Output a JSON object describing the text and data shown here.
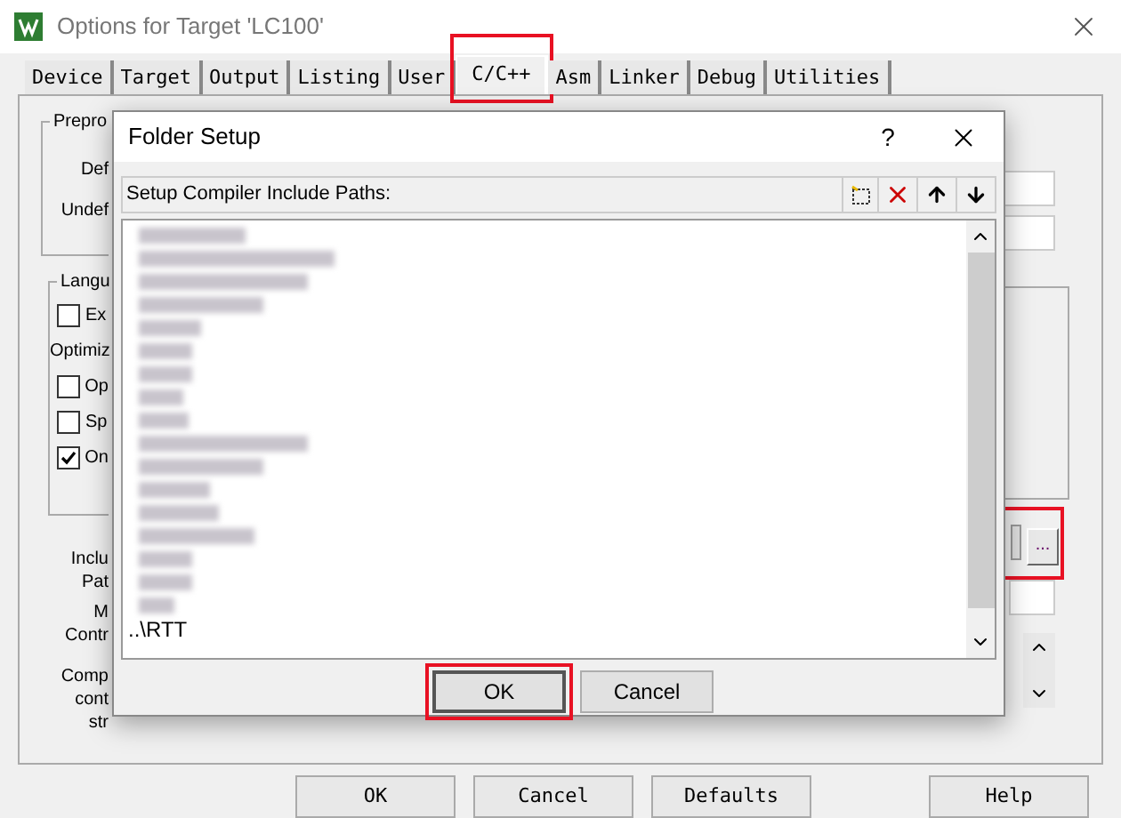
{
  "window": {
    "title": "Options for Target 'LC100'"
  },
  "tabs": [
    {
      "label": "Device",
      "selected": false,
      "highlighted": false
    },
    {
      "label": "Target",
      "selected": false,
      "highlighted": false
    },
    {
      "label": "Output",
      "selected": false,
      "highlighted": false
    },
    {
      "label": "Listing",
      "selected": false,
      "highlighted": false
    },
    {
      "label": "User",
      "selected": false,
      "highlighted": false
    },
    {
      "label": "C/C++",
      "selected": true,
      "highlighted": true
    },
    {
      "label": "Asm",
      "selected": false,
      "highlighted": false
    },
    {
      "label": "Linker",
      "selected": false,
      "highlighted": false
    },
    {
      "label": "Debug",
      "selected": false,
      "highlighted": false
    },
    {
      "label": "Utilities",
      "selected": false,
      "highlighted": false
    }
  ],
  "preprocessor_group": {
    "title": "Prepro",
    "labels": [
      "Def",
      "Undef"
    ]
  },
  "language_group": {
    "title": "Langu",
    "items": [
      {
        "kind": "checkbox",
        "label": "Ex",
        "checked": false
      },
      {
        "kind": "text",
        "label": "Optimiz"
      },
      {
        "kind": "checkbox",
        "label": "Op",
        "checked": false
      },
      {
        "kind": "checkbox",
        "label": "Sp",
        "checked": false
      },
      {
        "kind": "checkbox",
        "label": "On",
        "checked": true
      }
    ]
  },
  "include_labels": [
    "Inclu",
    "Pat"
  ],
  "misc_labels": [
    "M",
    "Contr"
  ],
  "compiler_labels": [
    "Comp",
    "cont",
    "str"
  ],
  "browse_button": {
    "label": "...",
    "highlighted": true
  },
  "buttons": [
    {
      "label": "OK"
    },
    {
      "label": "Cancel"
    },
    {
      "label": "Defaults"
    },
    {
      "label": "Help"
    }
  ],
  "folder_setup": {
    "title": "Folder Setup",
    "help": "?",
    "header": "Setup Compiler Include Paths:",
    "entries": [
      {
        "kind": "blurred"
      },
      {
        "kind": "blurred"
      },
      {
        "kind": "blurred"
      },
      {
        "kind": "blurred"
      },
      {
        "kind": "blurred"
      },
      {
        "kind": "blurred"
      },
      {
        "kind": "blurred"
      },
      {
        "kind": "blurred"
      },
      {
        "kind": "blurred"
      },
      {
        "kind": "blurred"
      },
      {
        "kind": "blurred"
      },
      {
        "kind": "blurred"
      },
      {
        "kind": "blurred"
      },
      {
        "kind": "blurred"
      },
      {
        "kind": "blurred"
      },
      {
        "kind": "blurred"
      },
      {
        "kind": "blurred"
      },
      {
        "kind": "path",
        "text": "..\\RTT"
      }
    ],
    "buttons": [
      {
        "label": "OK",
        "highlighted": true,
        "default": true
      },
      {
        "label": "Cancel",
        "highlighted": false,
        "default": false
      }
    ]
  }
}
